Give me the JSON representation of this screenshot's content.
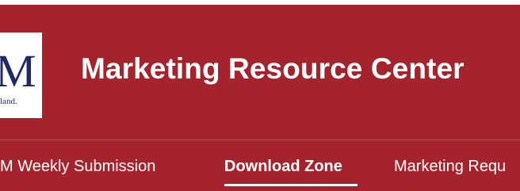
{
  "header": {
    "title": "Marketing Resource Center",
    "background_color": "#a4232c",
    "logo": {
      "letter": "M",
      "caption": "land.",
      "letter_color": "#1f2a6b"
    }
  },
  "nav": {
    "items": [
      {
        "label": "M Weekly Submission",
        "active": false
      },
      {
        "label": "Download Zone",
        "active": true
      },
      {
        "label": "Marketing Requ",
        "active": false
      }
    ],
    "active_indicator_color": "#ffffff"
  }
}
